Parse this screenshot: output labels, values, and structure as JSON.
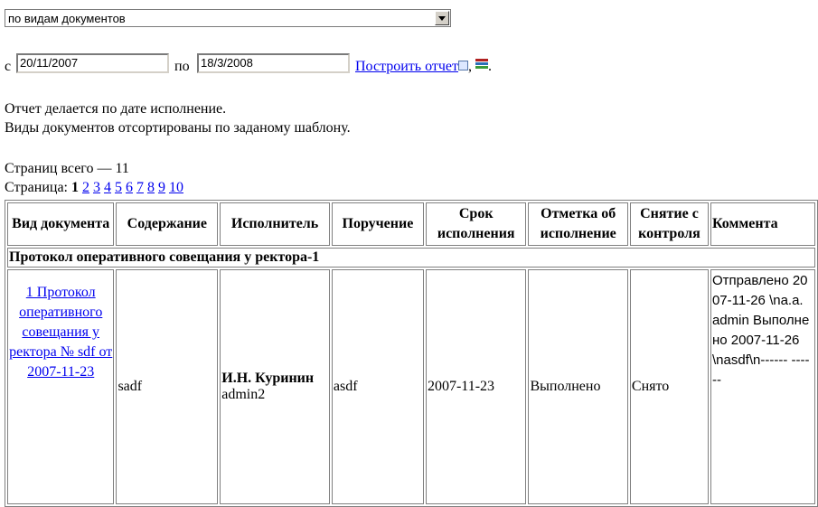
{
  "filter": {
    "selected": "по видам документов"
  },
  "range": {
    "from_label": "с",
    "from": "20/11/2007",
    "to_label": "по",
    "to": "18/3/2008",
    "build_link": "Построить отчет"
  },
  "notes": {
    "line1": "Отчет делается по дате исполнение.",
    "line2": "Виды документов отсортированы по заданому шаблону."
  },
  "pager": {
    "total": "Страниц всего — 11",
    "label": "Страница:",
    "current": "1",
    "pages": [
      "2",
      "3",
      "4",
      "5",
      "6",
      "7",
      "8",
      "9",
      "10"
    ]
  },
  "table": {
    "headers": [
      "Вид документа",
      "Содержание",
      "Исполнитель",
      "Поручение",
      "Срок исполнения",
      "Отметка об исполнение",
      "Снятие с контроля",
      "Коммента"
    ],
    "group": "Протокол оперативного совещания у ректора-1",
    "row": {
      "doc_link": "1 Протокол оперативного совещания у ректора № sdf от 2007-11-23",
      "content": "sadf",
      "executor_name": "И.Н. Куринин",
      "executor_login": "admin2",
      "order": "asdf",
      "deadline": "2007-11-23",
      "mark": "Выполнено",
      "control": "Снято",
      "comment": "Отправлено 2007-11-26 \\na.a. admin Выполнено 2007-11-26 \\nasdf\\n------ ------"
    }
  },
  "colors": {
    "link": "#0000ee",
    "border": "#808080"
  }
}
